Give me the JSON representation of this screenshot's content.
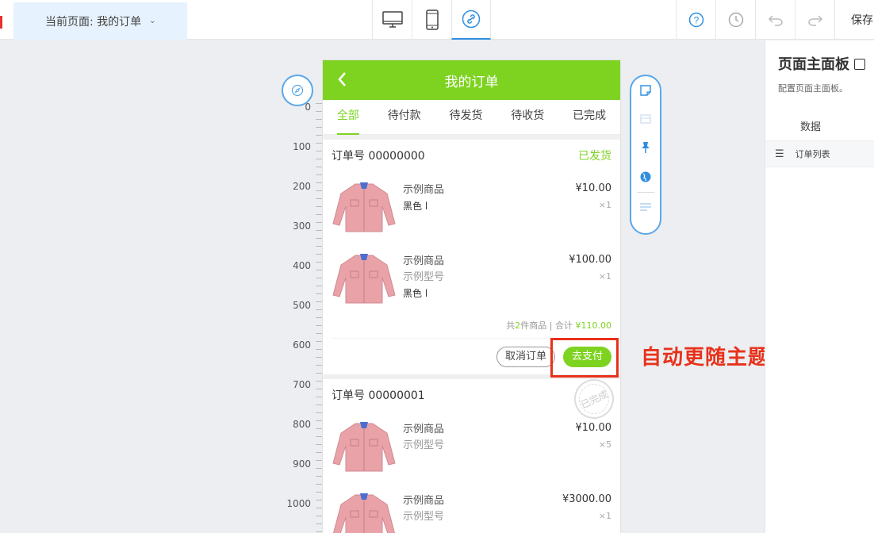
{
  "topbar": {
    "page_select_label": "当前页面: 我的订单",
    "device_buttons": [
      "desktop-icon",
      "mobile-icon",
      "link-icon"
    ],
    "active_device": "link-icon",
    "tools": [
      "help-icon",
      "history-icon",
      "undo-icon",
      "redo-icon"
    ],
    "save_label": "保存"
  },
  "ruler": {
    "labels": [
      "0",
      "100",
      "200",
      "300",
      "400",
      "500",
      "600",
      "700",
      "800",
      "900",
      "1000"
    ]
  },
  "phone": {
    "title": "我的订单",
    "tabs": [
      "全部",
      "待付款",
      "待发货",
      "待收货",
      "已完成"
    ],
    "active_tab": "全部",
    "orders": [
      {
        "order_no": "订单号 00000000",
        "status": "已发货",
        "items": [
          {
            "name": "示例商品",
            "spec": "",
            "color": "黑色 l",
            "price": "¥10.00",
            "qty": "×1"
          },
          {
            "name": "示例商品",
            "spec": "示例型号",
            "color": "黑色 l",
            "price": "¥100.00",
            "qty": "×1"
          }
        ],
        "summary_prefix": "共",
        "summary_count": "2",
        "summary_mid": "件商品 | 合计",
        "summary_total": "¥110.00",
        "cancel_label": "取消订单",
        "pay_label": "去支付"
      },
      {
        "order_no": "订单号 00000001",
        "stamp": "已完成",
        "items": [
          {
            "name": "示例商品",
            "spec": "示例型号",
            "price": "¥10.00",
            "qty": "×5"
          },
          {
            "name": "示例商品",
            "spec": "示例型号",
            "price": "¥3000.00",
            "qty": "×1"
          }
        ]
      }
    ]
  },
  "annotation": "自动更随主题",
  "side_toolbar": [
    "note-icon",
    "image-icon",
    "pin-icon",
    "globe-icon",
    "list-icon"
  ],
  "panel": {
    "title": "页面主面板",
    "desc": "配置页面主面板。",
    "section": "数据",
    "row_label": "订单列表"
  },
  "colors": {
    "theme_green": "#7ed321",
    "accent_blue": "#2f8ee0",
    "highlight_red": "#e8321b"
  }
}
